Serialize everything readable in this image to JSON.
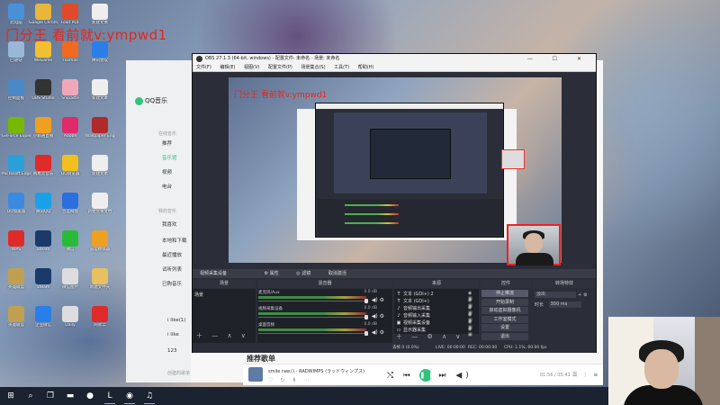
{
  "watermark": "门分王 看前就v:ympwd1",
  "desktop": {
    "icons": [
      {
        "label": "此电脑",
        "color": "#4a90d9"
      },
      {
        "label": "Google Chrome",
        "color": "#e8b63a"
      },
      {
        "label": "Foxit PDF",
        "color": "#e04a2a"
      },
      {
        "label": "新建文本",
        "color": "#eeeeee"
      },
      {
        "label": "回收站",
        "color": "#9ab8d8"
      },
      {
        "label": "WeGame",
        "color": "#f0c030"
      },
      {
        "label": "Foxmail",
        "color": "#f06a20"
      },
      {
        "label": "腾讯会议",
        "color": "#2a7ee8"
      },
      {
        "label": "控制面板",
        "color": "#4a88c8"
      },
      {
        "label": "OBS Studio",
        "color": "#333333"
      },
      {
        "label": "Snipaste",
        "color": "#f0a8b8"
      },
      {
        "label": "新建文本",
        "color": "#eeeeee"
      },
      {
        "label": "GeForce Experience",
        "color": "#76b900"
      },
      {
        "label": "小鹅通直播",
        "color": "#f0a020"
      },
      {
        "label": "Adobe",
        "color": "#e02a6a"
      },
      {
        "label": "Wallpaper Engine",
        "color": "#b02a2a"
      },
      {
        "label": "Microsoft Edge",
        "color": "#2aa0d8"
      },
      {
        "label": "网易云音乐",
        "color": "#e02a2a"
      },
      {
        "label": "QQ浏览器",
        "color": "#f0c020"
      },
      {
        "label": "新建文本",
        "color": "#eeeeee"
      },
      {
        "label": "UU加速器",
        "color": "#3a8ae0"
      },
      {
        "label": "腾讯QQ",
        "color": "#1aa0e8"
      },
      {
        "label": "百度网盘",
        "color": "#2a6ee0"
      },
      {
        "label": "新建文本文档",
        "color": "#eeeeee"
      },
      {
        "label": "WPS",
        "color": "#e02a2a"
      },
      {
        "label": "Steam",
        "color": "#1a3a6a"
      },
      {
        "label": "微信",
        "color": "#2aba3a"
      },
      {
        "label": "雷电模拟器",
        "color": "#f0a020"
      },
      {
        "label": "英雄联盟",
        "color": "#c0a050"
      },
      {
        "label": "Steam",
        "color": "#1a3a6a"
      },
      {
        "label": "微信图片",
        "color": "#dddddd"
      },
      {
        "label": "新建文件夹",
        "color": "#e8c060"
      },
      {
        "label": "英雄联盟",
        "color": "#c0a050"
      },
      {
        "label": "企业微信",
        "color": "#2a7ee8"
      },
      {
        "label": "Daily",
        "color": "#dddddd"
      },
      {
        "label": "网易云",
        "color": "#e02a2a"
      }
    ]
  },
  "qq": {
    "logo": "QQ音乐",
    "sections": [
      "在线音乐",
      "我的音乐"
    ],
    "items": [
      "推荐",
      "音乐馆",
      "视频",
      "电台",
      "我喜欢",
      "本地和下载",
      "最近播放",
      "试听列表",
      "已购音乐"
    ],
    "playlists": [
      "i like(1)",
      "i like",
      "123"
    ],
    "section_created": "创建的歌单",
    "header": "推荐歌单",
    "player": {
      "song": "smile raw.() - RADWIMPS (ラッドウィンプス)",
      "time": "01:56 / 05:41",
      "acts": "♡ ↻ ⬇ ⋯"
    }
  },
  "obs": {
    "title": "OBS 27.1.3 (64-bit, windows) - 配置文件: 未命名 - 场景: 未命名",
    "menu": [
      "文件(F)",
      "编辑(E)",
      "视图(V)",
      "配置文件(P)",
      "场景集合(S)",
      "工具(T)",
      "帮助(H)"
    ],
    "toolbar": {
      "title": "视频采集设备",
      "props": "⚙ 属性",
      "filters": "◎ 滤镜",
      "deactivate": "取消激活"
    },
    "docks": {
      "scenes": "场景",
      "mixer": "混音器",
      "sources": "来源",
      "controls": "控件",
      "transitions": "转场特效"
    },
    "scenes": [
      "场景"
    ],
    "mixer": [
      {
        "name": "麦克风/Aux",
        "db": "0.0 dB",
        "level": 0.2
      },
      {
        "name": "视频采集设备",
        "db": "0.0 dB",
        "level": 0.6
      },
      {
        "name": "桌面音频",
        "db": "0.0 dB",
        "level": 0.55
      }
    ],
    "sources": [
      {
        "name": "文本 (GDI+) 2",
        "icon": "T"
      },
      {
        "name": "文本 (GDI+)",
        "icon": "T"
      },
      {
        "name": "音频输出采集",
        "icon": "♪"
      },
      {
        "name": "音频输入采集",
        "icon": "♪"
      },
      {
        "name": "视频采集设备",
        "icon": "▣"
      },
      {
        "name": "显示器采集",
        "icon": "▭"
      }
    ],
    "controls": [
      "停止推流",
      "开始录制",
      "启动虚拟摄像机",
      "工作室模式",
      "设置",
      "退出"
    ],
    "transitions": {
      "mode": "淡出",
      "duration_label": "时长",
      "duration": "300 ms"
    },
    "status": {
      "dropped": "丢帧 0 (0.0%)",
      "live": "LIVE: 00:00:00",
      "rec": "REC: 00:00:00",
      "cpu": "CPU: 1.1%, 60.00 fps"
    }
  },
  "taskbar": {
    "icons": [
      {
        "name": "windows-icon",
        "glyph": "⊞",
        "active": false
      },
      {
        "name": "search-icon",
        "glyph": "⌕",
        "active": false
      },
      {
        "name": "taskview-icon",
        "glyph": "❐",
        "active": false
      },
      {
        "name": "explorer-icon",
        "glyph": "▬",
        "active": false
      },
      {
        "name": "chrome-icon",
        "glyph": "●",
        "active": false
      },
      {
        "name": "lol-icon",
        "glyph": "L",
        "active": true
      },
      {
        "name": "obs-icon",
        "glyph": "◉",
        "active": true
      },
      {
        "name": "qqmusic-icon",
        "glyph": "♫",
        "active": true
      }
    ]
  },
  "colors": {
    "accent": "#31c27c",
    "watermark": "#e0281e",
    "obs_bg": "#2b2e38"
  }
}
